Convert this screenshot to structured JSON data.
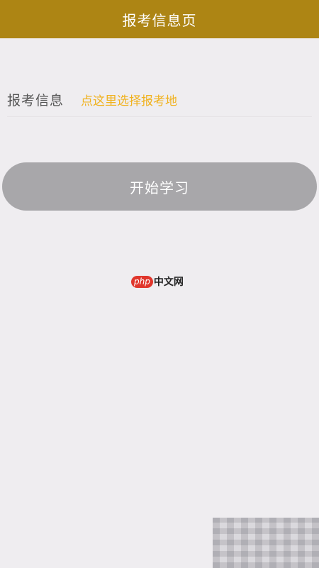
{
  "header": {
    "title": "报考信息页"
  },
  "form": {
    "label": "报考信息",
    "picker_placeholder": "点这里选择报考地"
  },
  "actions": {
    "start_label": "开始学习"
  },
  "watermark": {
    "php": "php",
    "cn": "中文网"
  },
  "colors": {
    "header_bg": "#ad8514",
    "picker_text": "#f0b21f",
    "button_bg": "#a8a7aa",
    "page_bg": "#efedf0"
  }
}
